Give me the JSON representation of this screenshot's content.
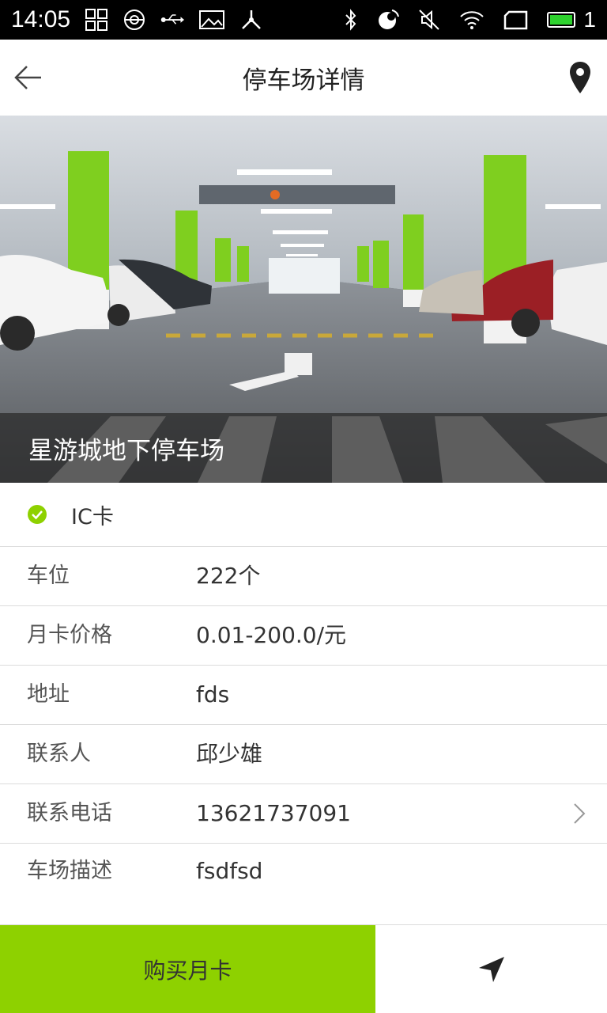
{
  "status_bar": {
    "time": "14:05",
    "battery_label": "1",
    "left_icons": [
      "grid-icon",
      "settings-app-icon",
      "usb-icon",
      "image-icon",
      "share-icon"
    ],
    "right_icons": [
      "bluetooth-icon",
      "sync-icon",
      "mute-icon",
      "wifi-icon",
      "sim-icon",
      "battery-icon"
    ]
  },
  "header": {
    "title": "停车场详情",
    "back_icon": "arrow-left-icon",
    "right_icon": "map-pin-icon"
  },
  "hero": {
    "name": "星游城地下停车场",
    "image": "underground-parking-lot-photo"
  },
  "features": [
    {
      "label": "IC卡",
      "checked": true
    }
  ],
  "details": {
    "spaces_label": "车位",
    "spaces_value": "222个",
    "monthly_price_label": "月卡价格",
    "monthly_price_value": "0.01-200.0/元",
    "address_label": "地址",
    "address_value": "fds",
    "contact_label": "联系人",
    "contact_value": "邱少雄",
    "phone_label": "联系电话",
    "phone_value": "13621737091",
    "description_label": "车场描述",
    "description_value": "fsdfsd"
  },
  "actions": {
    "buy_label": "购买月卡",
    "navigate_icon": "navigation-arrow-icon"
  },
  "colors": {
    "accent": "#8ed100",
    "check": "#8ed100",
    "divider": "#dcdcdc",
    "status_bar": "#000000"
  }
}
